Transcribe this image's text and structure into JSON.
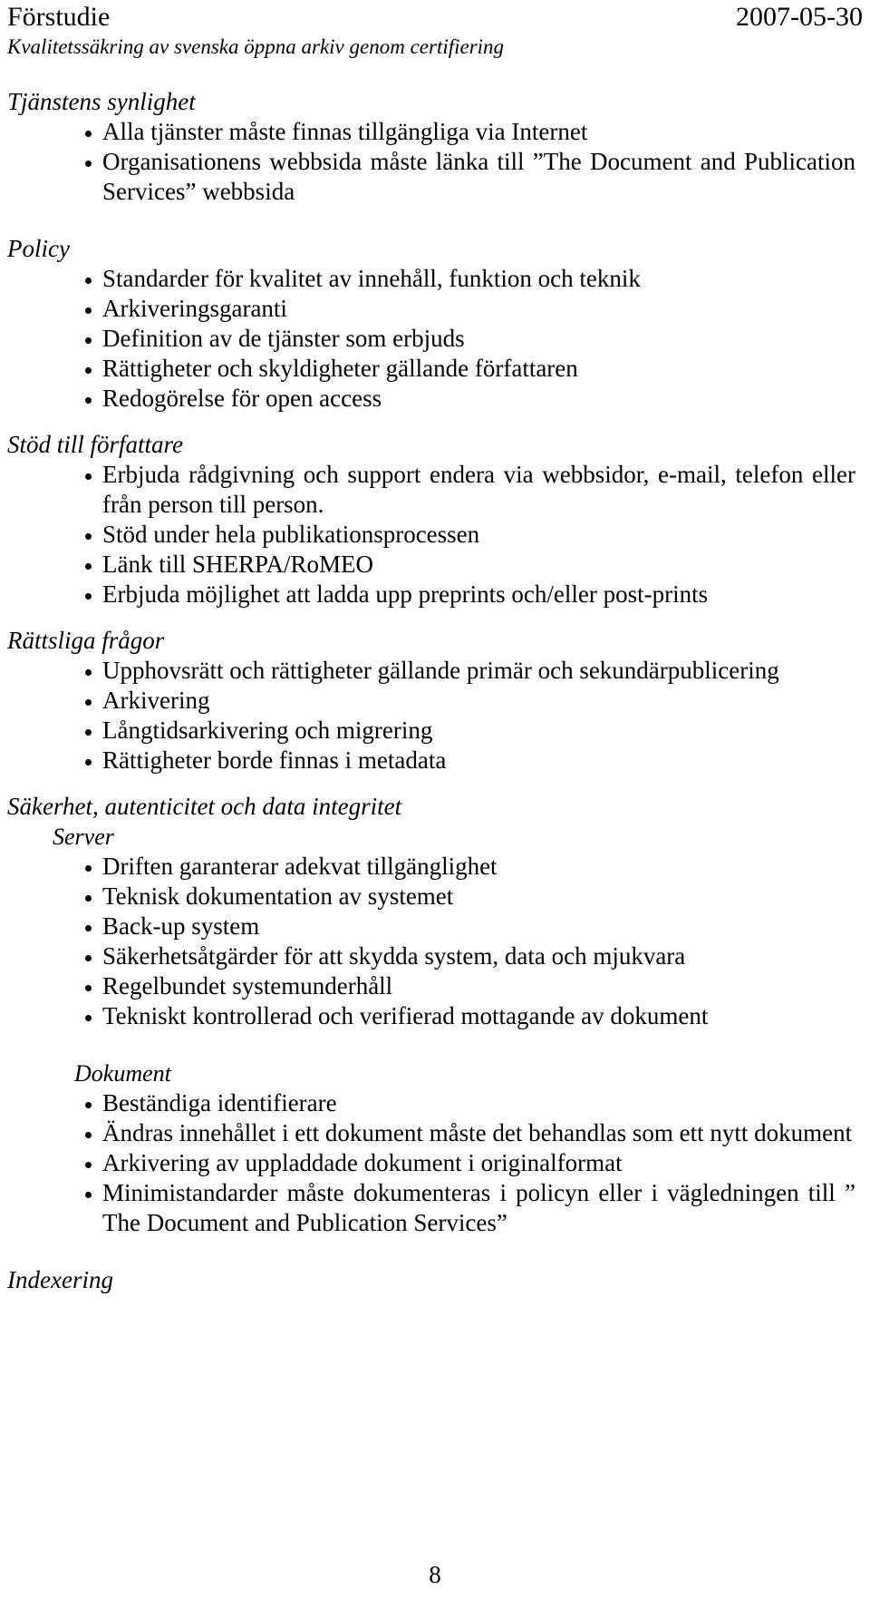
{
  "header": {
    "doc_type": "Förstudie",
    "date": "2007-05-30",
    "subtitle": "Kvalitetssäkring av svenska öppna arkiv genom certifiering"
  },
  "page_number": "8",
  "sections": [
    {
      "heading": "Tjänstens synlighet",
      "bullets": [
        "Alla tjänster måste finnas tillgängliga via Internet",
        "Organisationens webbsida måste länka till ”The Document and Publication Services” webbsida"
      ]
    },
    {
      "heading": "Policy",
      "bullets": [
        "Standarder för kvalitet av innehåll, funktion och teknik",
        "Arkiveringsgaranti",
        "Definition av de tjänster som erbjuds",
        "Rättigheter och skyldigheter gällande författaren",
        "Redogörelse för open access"
      ]
    },
    {
      "heading": "Stöd till författare",
      "bullets": [
        "Erbjuda rådgivning och support endera via webbsidor, e-mail, telefon eller från person till person.",
        "Stöd under hela publikationsprocessen",
        "Länk till SHERPA/RoMEO",
        "Erbjuda möjlighet att ladda upp preprints och/eller post-prints"
      ]
    },
    {
      "heading": "Rättsliga frågor",
      "bullets": [
        "Upphovsrätt och rättigheter gällande primär och sekundärpublicering",
        "Arkivering",
        "Långtidsarkivering och migrering",
        "Rättigheter borde finnas i metadata"
      ]
    },
    {
      "heading": "Säkerhet, autenticitet och data integritet",
      "sub_heading": "Server",
      "bullets": [
        "Driften garanterar adekvat tillgänglighet",
        "Teknisk dokumentation av systemet",
        "Back-up system",
        "Säkerhetsåtgärder för att skydda system, data och mjukvara",
        "Regelbundet systemunderhåll",
        "Tekniskt kontrollerad och verifierad mottagande av dokument"
      ]
    },
    {
      "heading": "Dokument",
      "bullets": [
        "Beständiga identifierare",
        "Ändras innehållet i ett dokument måste det behandlas som ett nytt dokument",
        "Arkivering av uppladdade dokument i originalformat",
        "Minimistandarder måste dokumenteras i policyn eller i vägledningen till ” The Document and Publication Services”"
      ]
    },
    {
      "heading": "Indexering",
      "bullets": []
    }
  ]
}
